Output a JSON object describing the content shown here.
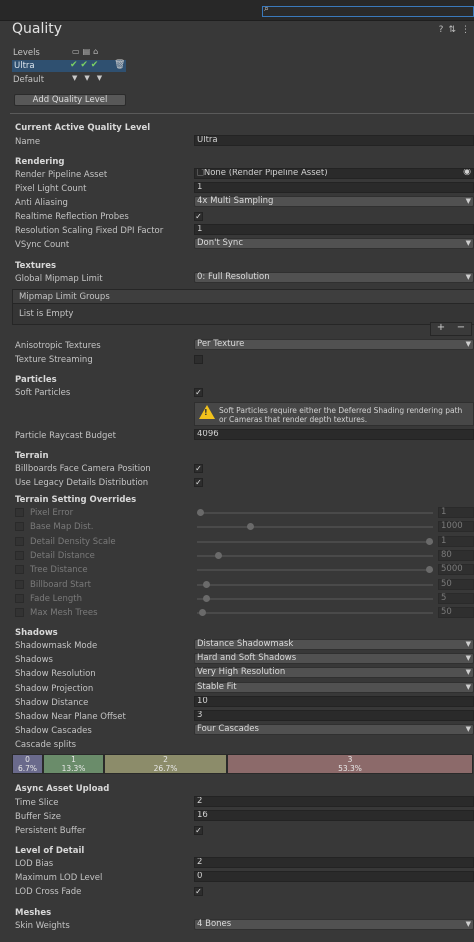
{
  "window": {
    "title": "Quality"
  },
  "levels": {
    "label": "Levels",
    "platform_icons": [
      "desktop-icon",
      "server-icon",
      "android-icon"
    ],
    "rows": [
      {
        "name": "Ultra",
        "checks": "✔ ✔ ✔"
      }
    ],
    "default_label": "Default",
    "add_button": "Add Quality Level"
  },
  "current": {
    "header": "Current Active Quality Level",
    "name_label": "Name",
    "name_value": "Ultra"
  },
  "rendering": {
    "header": "Rendering",
    "pipeline_label": "Render Pipeline Asset",
    "pipeline_value": "None (Render Pipeline Asset)",
    "pixel_light_label": "Pixel Light Count",
    "pixel_light_value": "1",
    "aa_label": "Anti Aliasing",
    "aa_value": "4x Multi Sampling",
    "reflection_label": "Realtime Reflection Probes",
    "reflection_checked": true,
    "dpi_label": "Resolution Scaling Fixed DPI Factor",
    "dpi_value": "1",
    "vsync_label": "VSync Count",
    "vsync_value": "Don't Sync"
  },
  "textures": {
    "header": "Textures",
    "mip_label": "Global Mipmap Limit",
    "mip_value": "0: Full Resolution",
    "groups_header": "Mipmap Limit Groups",
    "groups_empty": "List is Empty",
    "plus": "+",
    "minus": "−",
    "aniso_label": "Anisotropic Textures",
    "aniso_value": "Per Texture",
    "streaming_label": "Texture Streaming",
    "streaming_checked": false
  },
  "particles": {
    "header": "Particles",
    "soft_label": "Soft Particles",
    "soft_checked": true,
    "warning": "Soft Particles require either the Deferred Shading rendering path or Cameras that render depth textures.",
    "raycast_label": "Particle Raycast Budget",
    "raycast_value": "4096"
  },
  "terrain": {
    "header": "Terrain",
    "billboards_label": "Billboards Face Camera Position",
    "billboards_checked": true,
    "legacy_label": "Use Legacy Details Distribution",
    "legacy_checked": true
  },
  "overrides": {
    "header": "Terrain Setting Overrides",
    "items": [
      {
        "label": "Pixel Error",
        "value": "1",
        "fraction": 0.0
      },
      {
        "label": "Base Map Dist.",
        "value": "1000",
        "fraction": 0.22
      },
      {
        "label": "Detail Density Scale",
        "value": "1",
        "fraction": 1.0
      },
      {
        "label": "Detail Distance",
        "value": "80",
        "fraction": 0.08
      },
      {
        "label": "Tree Distance",
        "value": "5000",
        "fraction": 1.0
      },
      {
        "label": "Billboard Start",
        "value": "50",
        "fraction": 0.025
      },
      {
        "label": "Fade Length",
        "value": "5",
        "fraction": 0.025
      },
      {
        "label": "Max Mesh Trees",
        "value": "50",
        "fraction": 0.01
      }
    ]
  },
  "shadows": {
    "header": "Shadows",
    "mask_label": "Shadowmask Mode",
    "mask_value": "Distance Shadowmask",
    "shadows_label": "Shadows",
    "shadows_value": "Hard and Soft Shadows",
    "res_label": "Shadow Resolution",
    "res_value": "Very High Resolution",
    "proj_label": "Shadow Projection",
    "proj_value": "Stable Fit",
    "dist_label": "Shadow Distance",
    "dist_value": "10",
    "near_label": "Shadow Near Plane Offset",
    "near_value": "3",
    "cascades_label": "Shadow Cascades",
    "cascades_value": "Four Cascades",
    "splits_label": "Cascade splits",
    "splits": [
      {
        "index": "0",
        "percent": "6.7%",
        "share": 0.067,
        "color": "#6a6a8c"
      },
      {
        "index": "1",
        "percent": "13.3%",
        "share": 0.133,
        "color": "#6a8c6a"
      },
      {
        "index": "2",
        "percent": "26.7%",
        "share": 0.267,
        "color": "#8c8c6a"
      },
      {
        "index": "3",
        "percent": "53.3%",
        "share": 0.533,
        "color": "#8c6a6a"
      }
    ]
  },
  "async": {
    "header": "Async Asset Upload",
    "slice_label": "Time Slice",
    "slice_value": "2",
    "buffer_label": "Buffer Size",
    "buffer_value": "16",
    "persistent_label": "Persistent Buffer",
    "persistent_checked": true
  },
  "lod": {
    "header": "Level of Detail",
    "bias_label": "LOD Bias",
    "bias_value": "2",
    "max_label": "Maximum LOD Level",
    "max_value": "0",
    "fade_label": "LOD Cross Fade",
    "fade_checked": true
  },
  "meshes": {
    "header": "Meshes",
    "skin_label": "Skin Weights",
    "skin_value": "4 Bones"
  },
  "colors": {
    "accent": "#3a79bb",
    "selection": "#2f5070",
    "warning": "#f2c21c"
  }
}
